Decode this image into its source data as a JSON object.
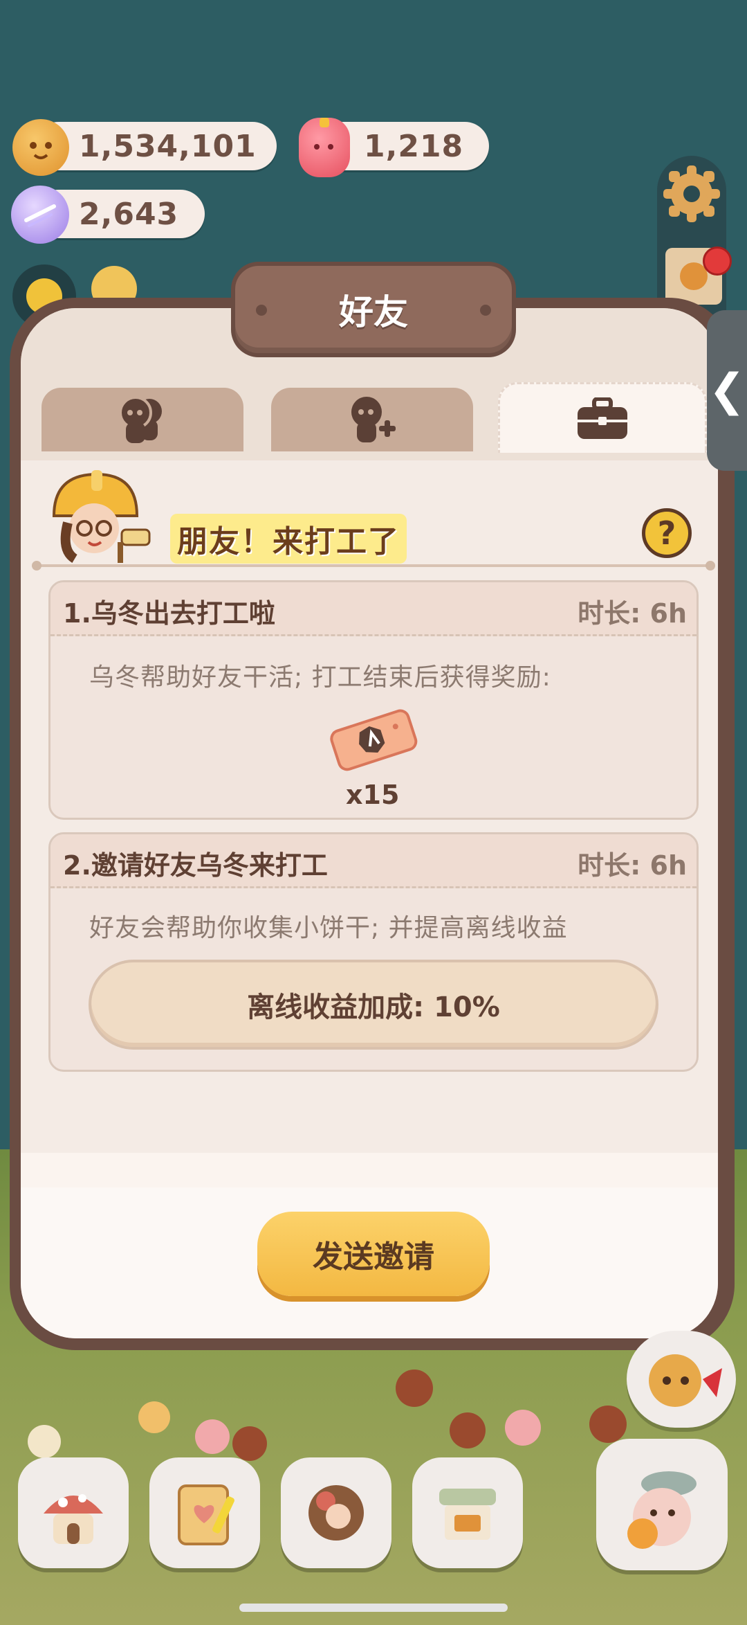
{
  "currencies": {
    "cookies": "1,534,101",
    "jelly": "1,218",
    "crystal": "2,643"
  },
  "side": {
    "collapse_arrow": "❮"
  },
  "dialog": {
    "title": "好友",
    "tabs": [
      {
        "icon": "friends-icon",
        "active": false
      },
      {
        "icon": "add-friend-icon",
        "active": false
      },
      {
        "icon": "briefcase-icon",
        "active": true
      }
    ],
    "headline": "朋友！来打工了",
    "help": "?"
  },
  "cards": [
    {
      "title": "1.乌冬出去打工啦",
      "duration": "时长: 6h",
      "description": "乌冬帮助好友干活; 打工结束后获得奖励:",
      "reward_count": "x15"
    },
    {
      "title": "2.邀请好友乌冬来打工",
      "duration": "时长: 6h",
      "description": "好友会帮助你收集小饼干; 并提高离线收益",
      "bonus": "离线收益加成: 10%"
    }
  ],
  "actions": {
    "send_invite": "发送邀请"
  },
  "colors": {
    "background": "#2d5d63",
    "dialog_frame": "#6a4c42",
    "button_gold": "#f3b842",
    "text_brown": "#5f4033"
  }
}
